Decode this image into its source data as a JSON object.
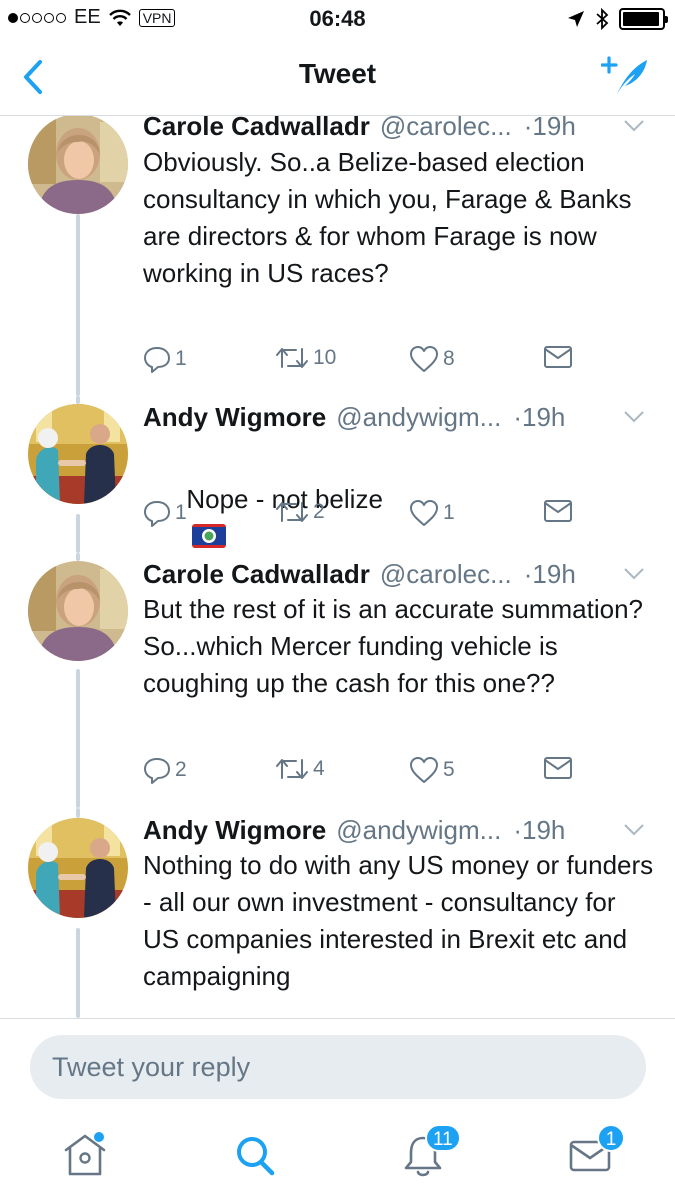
{
  "status_bar": {
    "carrier": "EE",
    "vpn": "VPN",
    "time": "06:48",
    "signal_bars_filled": 1,
    "signal_bars_total": 5,
    "battery_level": 0.95
  },
  "nav": {
    "title": "Tweet",
    "back_icon": "chevron-left-icon",
    "compose_icon": "compose-tweet-icon"
  },
  "tweets": [
    {
      "name": "Carole Cadwalladr",
      "handle": "@carolec...",
      "time": "·19h",
      "text": "Obviously. So..a Belize-based election consultancy in which you, Farage & Banks are directors & for whom Farage is now working in US races?",
      "replies": "1",
      "retweets": "10",
      "likes": "8",
      "avatar": "woman-portrait"
    },
    {
      "name": "Andy Wigmore",
      "handle": "@andywigm...",
      "time": "·19h",
      "text": "Nope - not belize",
      "flag": "belize-flag-emoji",
      "replies": "1",
      "retweets": "2",
      "likes": "1",
      "avatar": "handshake-photo"
    },
    {
      "name": "Carole Cadwalladr",
      "handle": "@carolec...",
      "time": "·19h",
      "text": "But the rest of it is an accurate summation?\nSo...which Mercer funding vehicle is coughing up the cash for this one??",
      "replies": "2",
      "retweets": "4",
      "likes": "5",
      "avatar": "woman-portrait"
    },
    {
      "name": "Andy Wigmore",
      "handle": "@andywigm...",
      "time": "·19h",
      "text": "Nothing to do with any US money or funders - all our own investment - consultancy for US companies interested in Brexit etc and campaigning",
      "avatar": "handshake-photo"
    }
  ],
  "reply": {
    "placeholder": "Tweet your reply"
  },
  "tab_bar": {
    "items": [
      {
        "name": "home",
        "icon": "home-icon",
        "has_dot": true
      },
      {
        "name": "search",
        "icon": "search-icon",
        "active": true
      },
      {
        "name": "notifications",
        "icon": "bell-icon",
        "badge": "11"
      },
      {
        "name": "messages",
        "icon": "envelope-icon",
        "badge": "1"
      }
    ]
  },
  "colors": {
    "accent": "#1da1f2",
    "text": "#14171a",
    "secondary": "#657786",
    "thread_line": "#cbd5de",
    "reply_bg": "#e6ecf0"
  }
}
